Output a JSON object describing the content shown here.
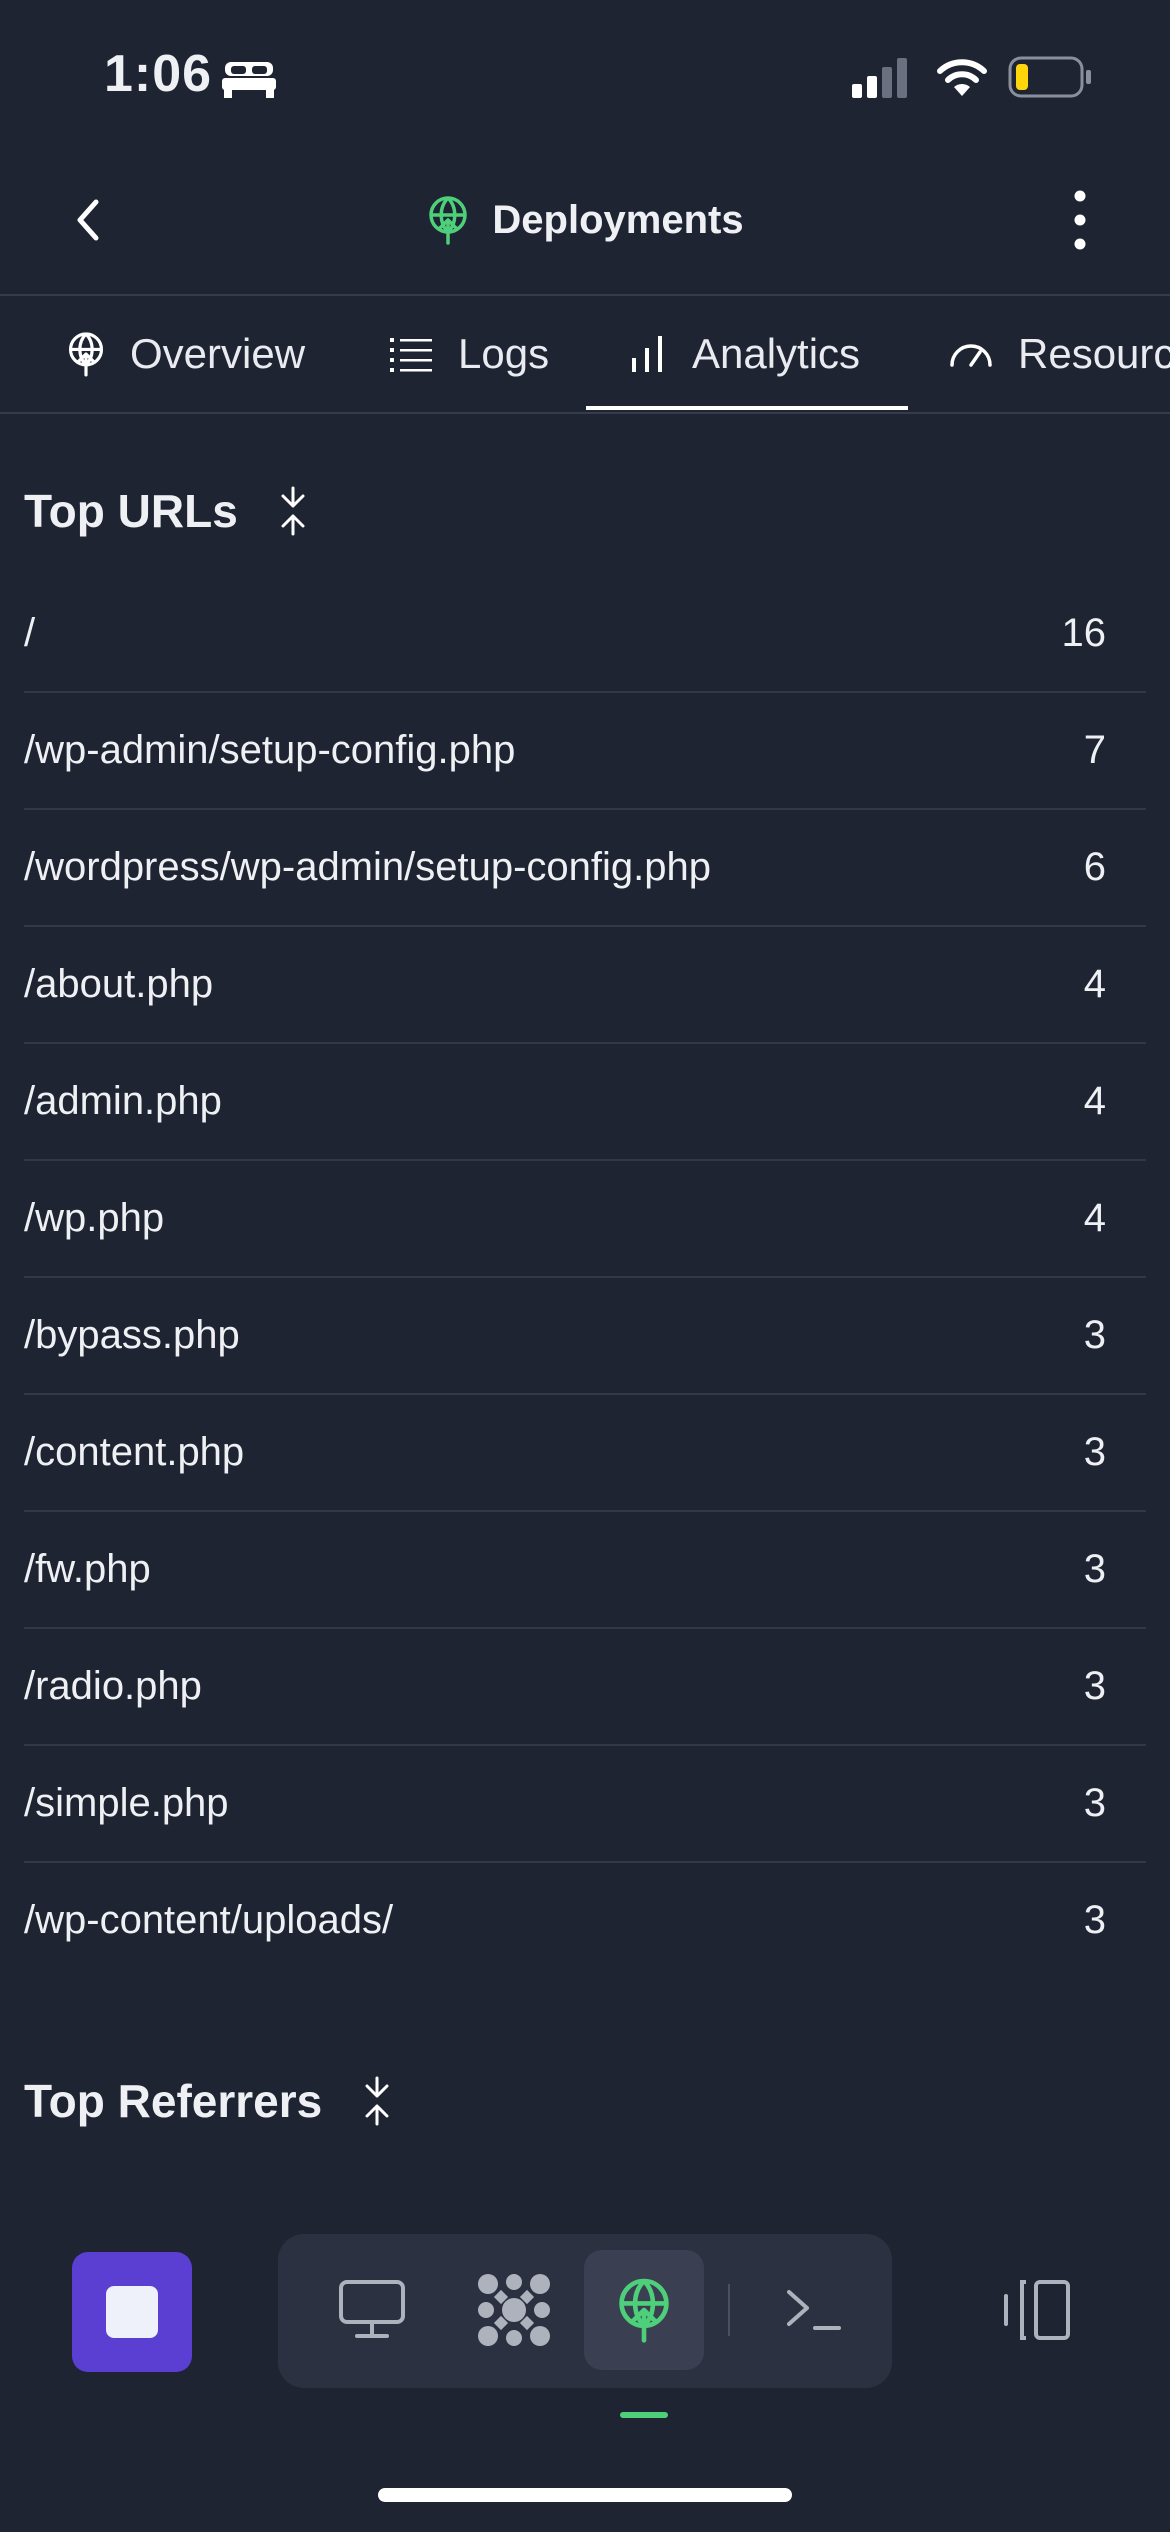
{
  "status_bar": {
    "time": "1:06",
    "icons": [
      "bed-icon",
      "cellular-signal-icon",
      "wifi-icon",
      "battery-low-icon"
    ],
    "battery_color": "#ffd60a"
  },
  "header": {
    "title": "Deployments",
    "icons": [
      "back-chevron-icon",
      "deployments-icon",
      "more-vertical-icon"
    ],
    "accent_color": "#4ed07a"
  },
  "tabs": [
    {
      "label": "Overview",
      "icon": "deployments-icon"
    },
    {
      "label": "Logs",
      "icon": "list-icon"
    },
    {
      "label": "Analytics",
      "icon": "bar-chart-icon",
      "active": true
    },
    {
      "label": "Resources",
      "icon": "gauge-icon"
    }
  ],
  "top_urls": {
    "title": "Top URLs",
    "icon": "collapse-icon",
    "rows": [
      {
        "url": "/",
        "count": "16"
      },
      {
        "url": "/wp-admin/setup-config.php",
        "count": "7"
      },
      {
        "url": "/wordpress/wp-admin/setup-config.php",
        "count": "6"
      },
      {
        "url": "/about.php",
        "count": "4"
      },
      {
        "url": "/admin.php",
        "count": "4"
      },
      {
        "url": "/wp.php",
        "count": "4"
      },
      {
        "url": "/bypass.php",
        "count": "3"
      },
      {
        "url": "/content.php",
        "count": "3"
      },
      {
        "url": "/fw.php",
        "count": "3"
      },
      {
        "url": "/radio.php",
        "count": "3"
      },
      {
        "url": "/simple.php",
        "count": "3"
      },
      {
        "url": "/wp-content/uploads/",
        "count": "3"
      }
    ]
  },
  "top_referrers": {
    "title": "Top Referrers",
    "icon": "collapse-icon"
  },
  "bottom_bar": {
    "items": [
      "stop-icon",
      "desktop-icon",
      "apps-grid-icon",
      "deployments-icon",
      "terminal-icon",
      "split-view-icon"
    ],
    "stop_color": "#5b3fd3"
  }
}
